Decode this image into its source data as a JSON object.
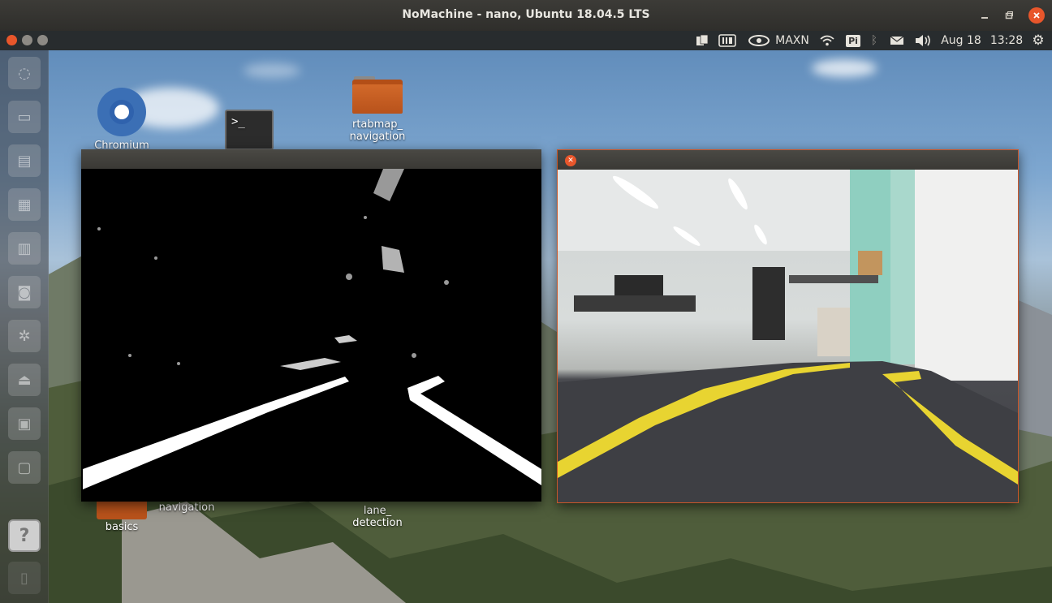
{
  "window": {
    "title": "NoMachine - nano, Ubuntu 18.04.5 LTS",
    "minimize_icon": "minimize-icon",
    "restore_icon": "restore-icon",
    "close_icon": "close-icon"
  },
  "panel": {
    "power_mode": "MAXN",
    "pi_label": "Pi",
    "date": "Aug 18",
    "time": "13:28"
  },
  "desktop_icons": {
    "chromium": "Chromium",
    "rtabmap_line1": "rtabmap_",
    "rtabmap_line2": "navigation",
    "navigation": "navigation",
    "basics": "basics",
    "lane_line1": "lane_",
    "lane_line2": "detection"
  },
  "launcher": {
    "help_label": "?"
  },
  "terminal_prompt": ">_",
  "colors": {
    "accent_close": "#e8562b",
    "lane_yellow": "#e8d431",
    "folder_orange": "#c75e20"
  }
}
